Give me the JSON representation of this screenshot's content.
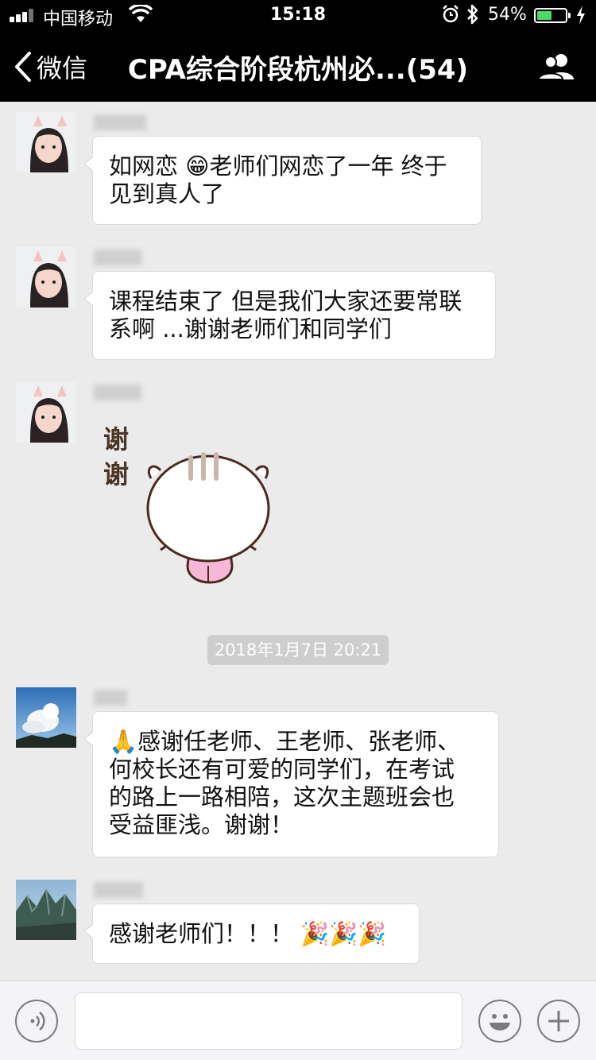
{
  "status_bar": {
    "carrier": "中国移动",
    "time": "15:18",
    "battery_percent": "54%",
    "battery_level": 0.54,
    "icons": [
      "signal-icon",
      "wifi-icon",
      "alarm-icon",
      "bluetooth-icon",
      "battery-icon",
      "charging-icon"
    ]
  },
  "nav": {
    "back_label": "微信",
    "title": "CPA综合阶段杭州必...(54)",
    "right_icon": "group-members-icon"
  },
  "messages": [
    {
      "type": "text",
      "lines": [
        "如网恋 😁老师们网恋了一年 终于",
        "见到真人了"
      ]
    },
    {
      "type": "text",
      "lines": [
        "课程结束了 但是我们大家还要常联",
        "系啊 ...谢谢老师们和同学们"
      ]
    },
    {
      "type": "sticker",
      "sticker_text": [
        "谢",
        "谢"
      ]
    },
    {
      "type": "text",
      "lines": [
        "🙏感谢任老师、王老师、张老师、",
        "何校长还有可爱的同学们，在考试",
        "的路上一路相陪，这次主题班会也",
        "受益匪浅。谢谢！"
      ]
    },
    {
      "type": "text",
      "lines": [
        "感谢老师们！！！ 🎉🎉🎉"
      ]
    }
  ],
  "timestamp": "2018年1月7日 20:21",
  "input_bar": {
    "icons": [
      "voice-icon",
      "emoji-icon",
      "plus-icon"
    ]
  },
  "colors": {
    "nav_bg": "#000000",
    "chat_bg": "#ebebeb",
    "bubble_bg": "#ffffff",
    "battery_fill": "#4cd964",
    "timestamp_bg": "#cecece"
  }
}
